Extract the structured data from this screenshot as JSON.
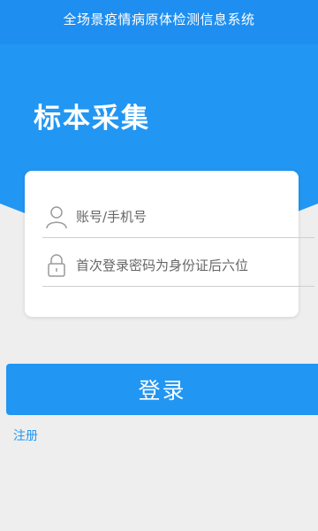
{
  "app_title": "全场景疫情病原体检测信息系统",
  "heading": "标本采集",
  "form": {
    "account_placeholder": "账号/手机号",
    "password_placeholder": "首次登录密码为身份证后六位",
    "account_icon": "user-icon",
    "password_icon": "lock-icon"
  },
  "login_label": "登录",
  "register_label": "注册",
  "colors": {
    "primary": "#2196f3",
    "background": "#eeeeee",
    "card": "#ffffff"
  }
}
